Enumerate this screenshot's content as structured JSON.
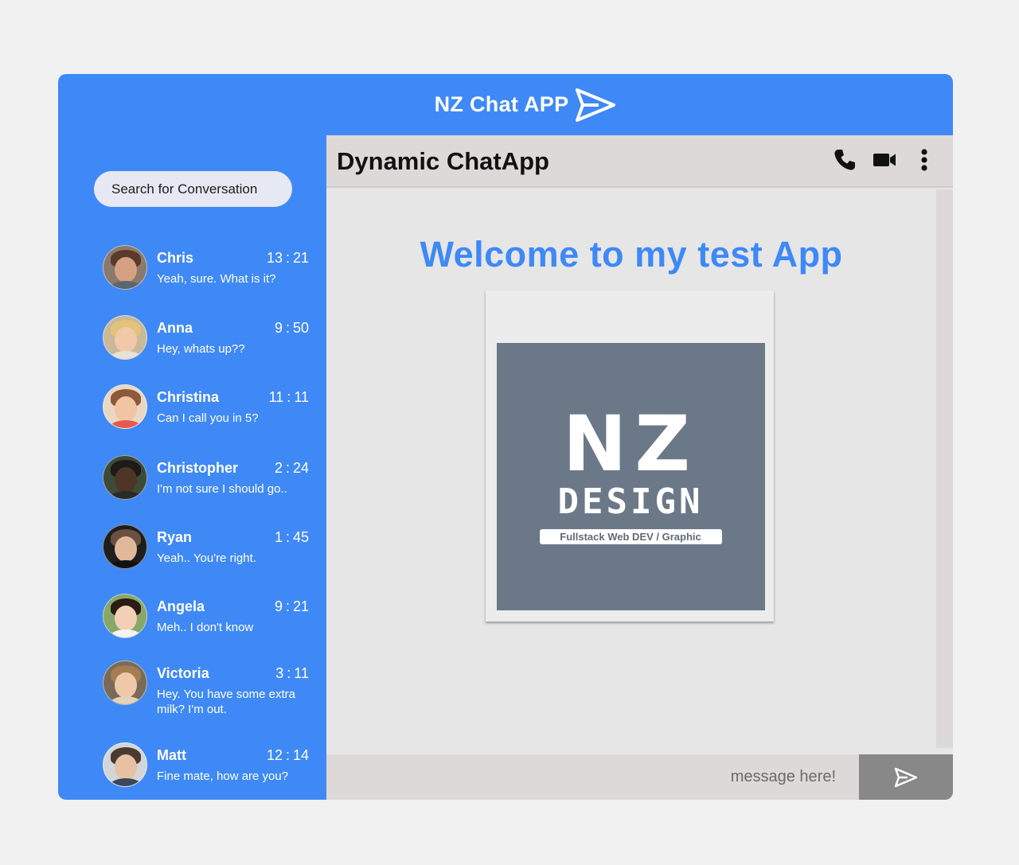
{
  "app": {
    "title": "NZ Chat APP"
  },
  "sidebar": {
    "search_label": "Search for Conversation",
    "conversations": [
      {
        "name": "Chris",
        "time": "13 : 21",
        "message": "Yeah, sure. What is it?"
      },
      {
        "name": "Anna",
        "time": "9 : 50",
        "message": "Hey, whats up??"
      },
      {
        "name": "Christina",
        "time": "11 : 11",
        "message": "Can I call you in 5?"
      },
      {
        "name": "Christopher",
        "time": "2 : 24",
        "message": "I'm not sure I should go.."
      },
      {
        "name": "Ryan",
        "time": "1 : 45",
        "message": "Yeah.. You're right."
      },
      {
        "name": "Angela",
        "time": "9 : 21",
        "message": "Meh.. I don't know"
      },
      {
        "name": "Victoria",
        "time": "3 : 11",
        "message": "Hey. You have some extra milk? I'm out."
      },
      {
        "name": "Matt",
        "time": "12 : 14",
        "message": "Fine mate, how are you?"
      }
    ]
  },
  "chat": {
    "title": "Dynamic ChatApp",
    "welcome": "Welcome to my test App",
    "logo": {
      "line1": "NZ",
      "line2": "DESIGN",
      "tagline": "Fullstack Web DEV  /  Graphic"
    },
    "input_placeholder": "message here!"
  },
  "colors": {
    "brand_blue": "#3f89f6",
    "panel_grey": "#dcd9d8",
    "logo_bg": "#6b7887"
  },
  "icons": [
    "send-plane-icon",
    "phone-icon",
    "video-camera-icon",
    "more-vertical-icon"
  ]
}
